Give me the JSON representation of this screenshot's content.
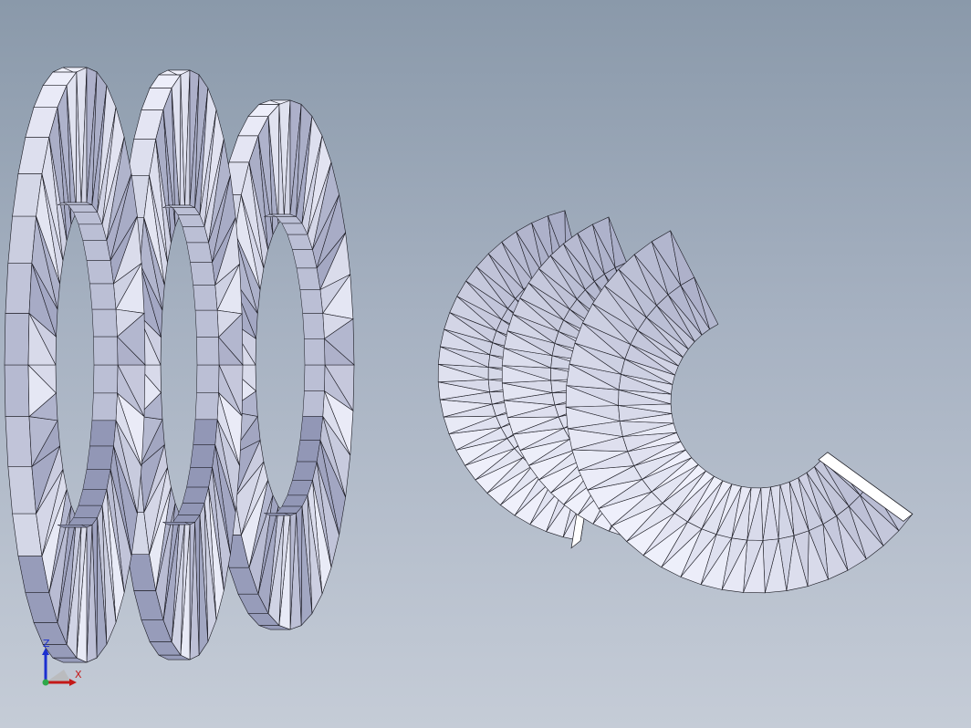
{
  "viewport": {
    "background_top": "#8a99aa",
    "background_bottom": "#c5ccd7"
  },
  "model": {
    "face_color": "#c3c8ef",
    "face_light": "#f4f5ff",
    "face_shade": "#8d92b2",
    "edge_color": "#1a1a22",
    "left_group": {
      "washer_count": 3,
      "style": "stacked-rings"
    },
    "right_group": {
      "washer_count": 3,
      "style": "section-cut"
    }
  },
  "triad": {
    "z_label": "Z",
    "x_label": "X",
    "z_color": "#1b2fd0",
    "x_color": "#c41818",
    "y_color": "#2ea84a"
  }
}
